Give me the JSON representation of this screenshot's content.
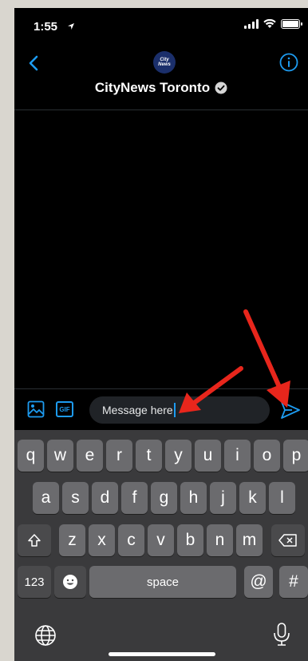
{
  "status_bar": {
    "time": "1:55"
  },
  "header": {
    "avatar_text_line1": "City",
    "avatar_text_line2": "News",
    "title": "CityNews Toronto"
  },
  "composer": {
    "message_text": "Message here"
  },
  "keyboard": {
    "row1": [
      "q",
      "w",
      "e",
      "r",
      "t",
      "y",
      "u",
      "i",
      "o",
      "p"
    ],
    "row2": [
      "a",
      "s",
      "d",
      "f",
      "g",
      "h",
      "j",
      "k",
      "l"
    ],
    "row3": [
      "z",
      "x",
      "c",
      "v",
      "b",
      "n",
      "m"
    ],
    "numbers_label": "123",
    "space_label": "space",
    "at_label": "@",
    "hash_label": "#"
  },
  "colors": {
    "accent": "#1d9bf0",
    "annotation_arrow": "#e8261c"
  }
}
